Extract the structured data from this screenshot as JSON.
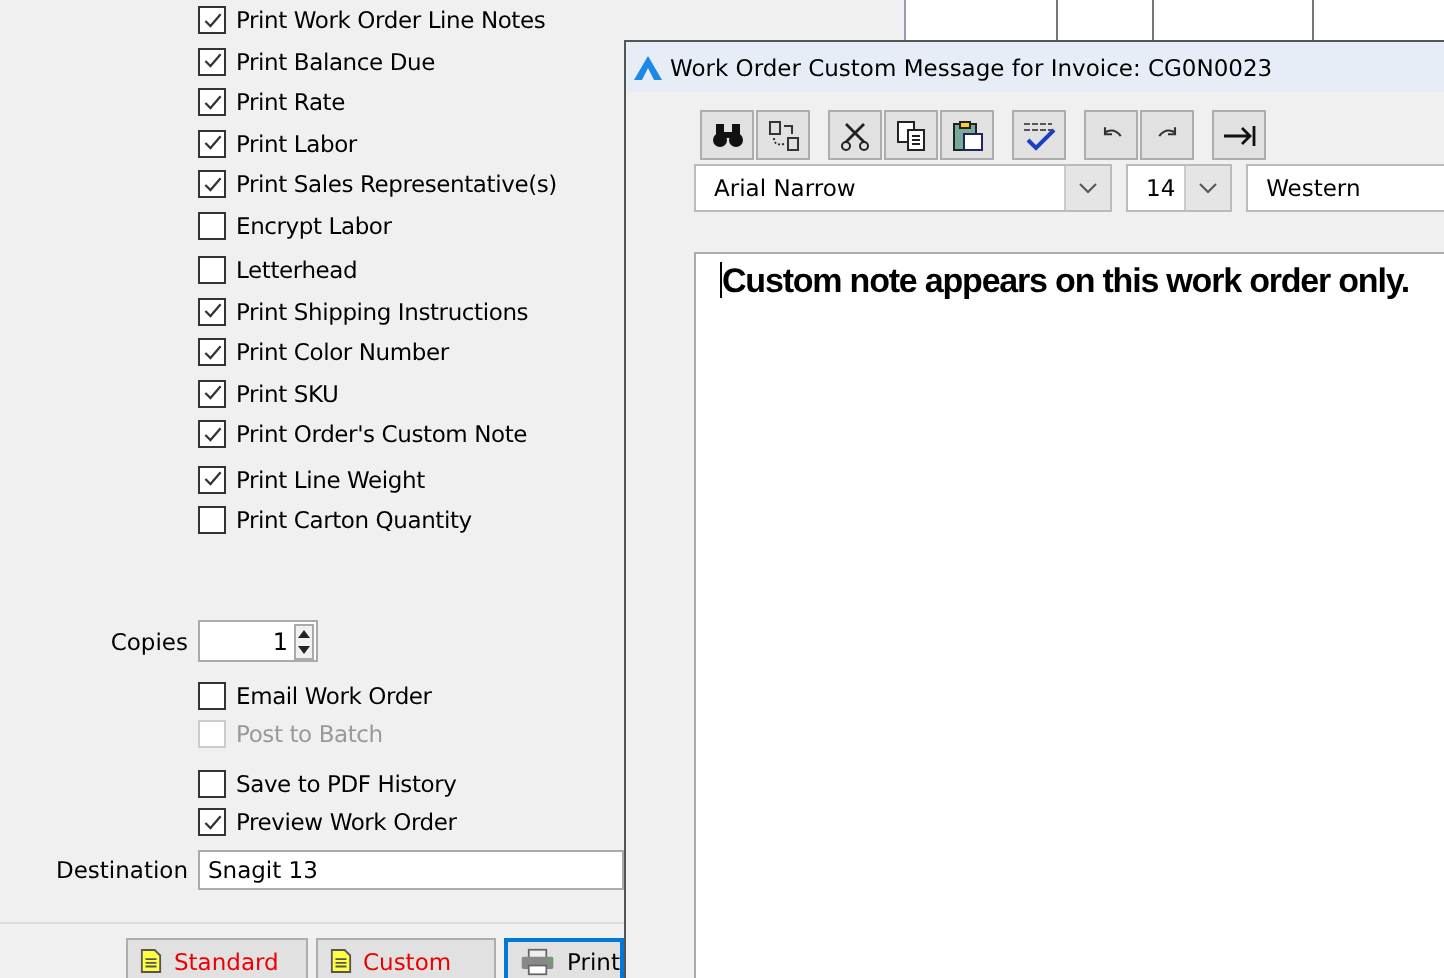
{
  "print_options": [
    {
      "label": "Print Work Order Line Notes",
      "checked": true
    },
    {
      "label": "Print Balance Due",
      "checked": true
    },
    {
      "label": "Print Rate",
      "checked": true
    },
    {
      "label": "Print Labor",
      "checked": true
    },
    {
      "label": "Print Sales Representative(s)",
      "checked": true
    },
    {
      "label": "Encrypt Labor",
      "checked": false
    },
    {
      "label": "Letterhead",
      "checked": false
    },
    {
      "label": "Print Shipping Instructions",
      "checked": true
    },
    {
      "label": "Print Color Number",
      "checked": true
    },
    {
      "label": "Print SKU",
      "checked": true
    },
    {
      "label": "Print Order's Custom Note",
      "checked": true
    },
    {
      "label": "Print Line Weight",
      "checked": true
    },
    {
      "label": "Print Carton Quantity",
      "checked": false
    }
  ],
  "copies": {
    "label": "Copies",
    "value": "1"
  },
  "output_options": [
    {
      "label": "Email Work Order",
      "checked": false,
      "disabled": false
    },
    {
      "label": "Post to Batch",
      "checked": false,
      "disabled": true
    },
    {
      "label": "Save to PDF History",
      "checked": false,
      "disabled": false
    },
    {
      "label": "Preview Work Order",
      "checked": true,
      "disabled": false
    }
  ],
  "destination": {
    "label": "Destination",
    "value": "Snagit 13"
  },
  "buttons": [
    {
      "label": "Standard",
      "kind": "report",
      "selected": false
    },
    {
      "label": "Custom",
      "kind": "report",
      "selected": false
    },
    {
      "label": "Print",
      "kind": "print",
      "selected": true
    }
  ],
  "dialog": {
    "title": "Work Order Custom Message for Invoice: CG0N0023",
    "toolbar": [
      {
        "kind": "find"
      },
      {
        "kind": "replace"
      },
      {
        "kind": "cut"
      },
      {
        "kind": "copy"
      },
      {
        "kind": "paste"
      },
      {
        "kind": "spell"
      },
      {
        "kind": "undo"
      },
      {
        "kind": "redo"
      },
      {
        "kind": "tab"
      }
    ],
    "font": "Arial Narrow",
    "size": "14",
    "script": "Western",
    "message": "Custom note appears on this work order only."
  }
}
